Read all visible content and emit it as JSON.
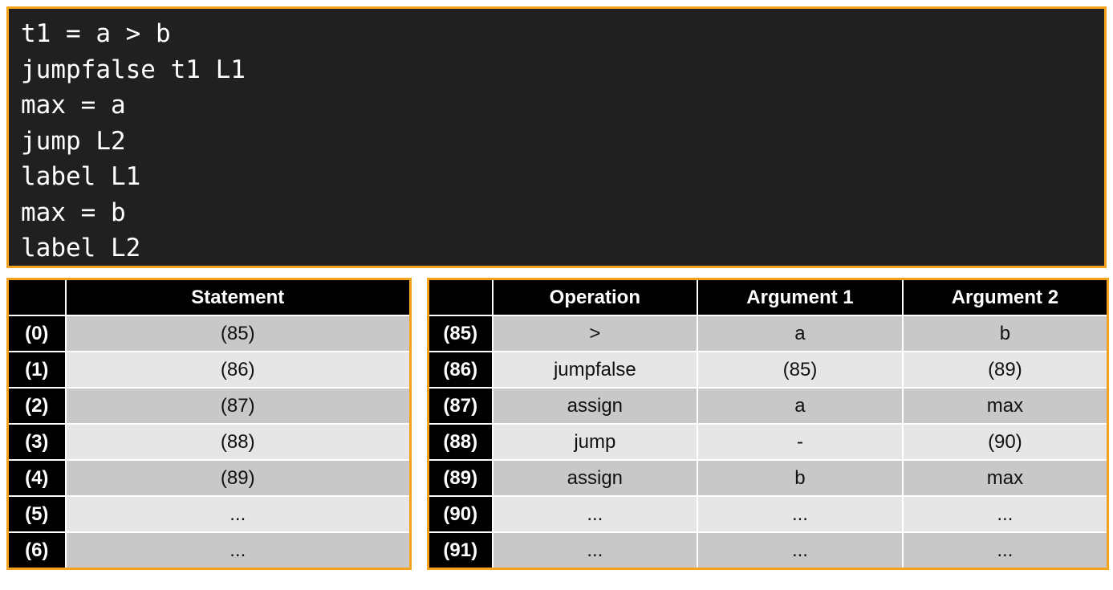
{
  "code": {
    "lines": [
      "t1 = a > b",
      "jumpfalse t1 L1",
      "max = a",
      "jump L2",
      "label L1",
      "max = b",
      "label L2"
    ]
  },
  "statement_table": {
    "headers": [
      "",
      "Statement"
    ],
    "rows": [
      {
        "index": "(0)",
        "statement": "(85)"
      },
      {
        "index": "(1)",
        "statement": "(86)"
      },
      {
        "index": "(2)",
        "statement": "(87)"
      },
      {
        "index": "(3)",
        "statement": "(88)"
      },
      {
        "index": "(4)",
        "statement": "(89)"
      },
      {
        "index": "(5)",
        "statement": "..."
      },
      {
        "index": "(6)",
        "statement": "..."
      }
    ]
  },
  "quad_table": {
    "headers": [
      "",
      "Operation",
      "Argument 1",
      "Argument 2"
    ],
    "rows": [
      {
        "index": "(85)",
        "op": ">",
        "arg1": "a",
        "arg2": "b"
      },
      {
        "index": "(86)",
        "op": "jumpfalse",
        "arg1": "(85)",
        "arg2": "(89)"
      },
      {
        "index": "(87)",
        "op": "assign",
        "arg1": "a",
        "arg2": "max"
      },
      {
        "index": "(88)",
        "op": "jump",
        "arg1": "-",
        "arg2": "(90)"
      },
      {
        "index": "(89)",
        "op": "assign",
        "arg1": "b",
        "arg2": "max"
      },
      {
        "index": "(90)",
        "op": "...",
        "arg1": "...",
        "arg2": "..."
      },
      {
        "index": "(91)",
        "op": "...",
        "arg1": "...",
        "arg2": "..."
      }
    ]
  },
  "colors": {
    "accent_border": "#f5a21c",
    "code_background": "#202020",
    "header_background": "#000000"
  }
}
